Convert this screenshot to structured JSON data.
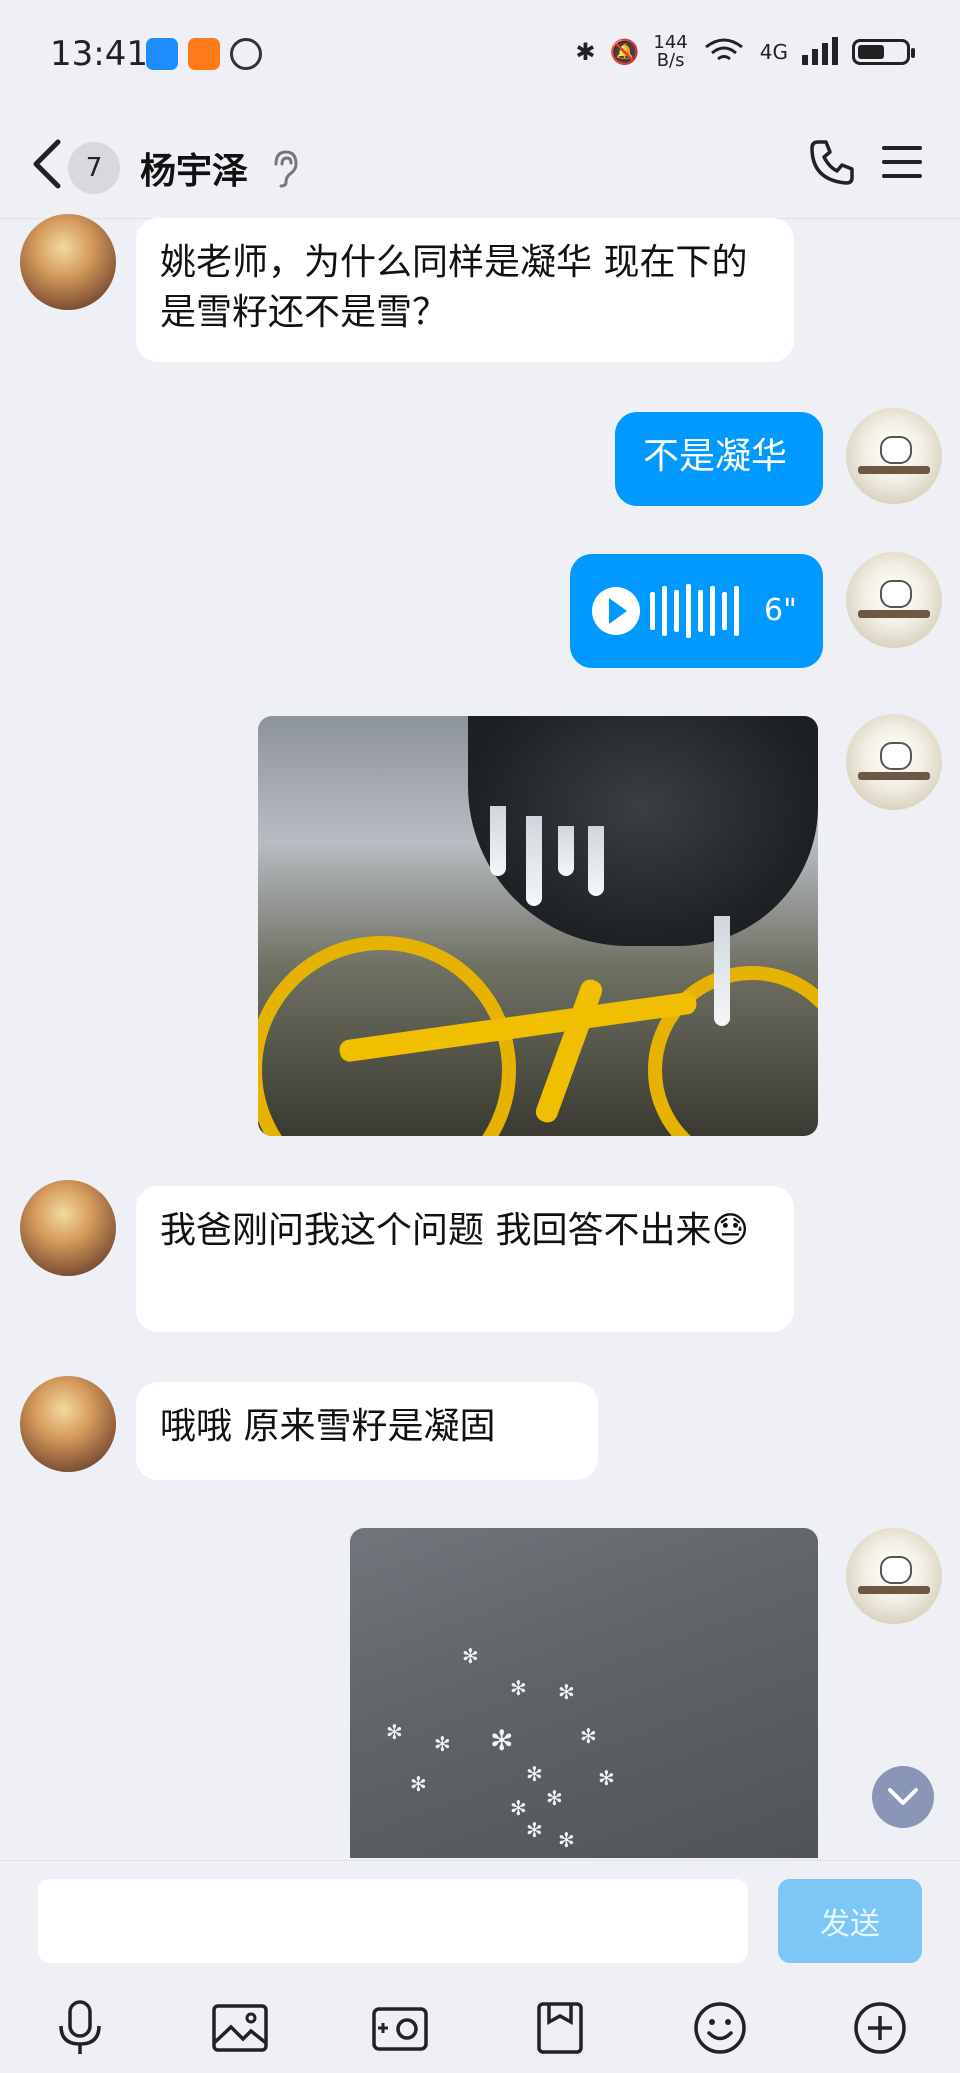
{
  "status_bar": {
    "time": "13:41",
    "net_speed_value": "144",
    "net_speed_unit": "B/s",
    "wifi_label": "6",
    "cell_label": "4G"
  },
  "header": {
    "unread_count": "7",
    "contact_name": "杨宇泽"
  },
  "messages": [
    {
      "from": "other",
      "type": "text",
      "text": "姚老师，为什么同样是凝华  现在下的是雪籽还不是雪？"
    },
    {
      "from": "me",
      "type": "text",
      "text": "不是凝华"
    },
    {
      "from": "me",
      "type": "voice",
      "duration": "6\""
    },
    {
      "from": "me",
      "type": "image",
      "description": "bike-icicles"
    },
    {
      "from": "other",
      "type": "text",
      "text": "我爸刚问我这个问题 我回答不出来😓"
    },
    {
      "from": "other",
      "type": "text",
      "text": "哦哦  原来雪籽是凝固"
    },
    {
      "from": "me",
      "type": "image",
      "description": "snowflakes-on-fabric"
    }
  ],
  "input": {
    "value": "",
    "send_label": "发送"
  },
  "toolbar": [
    "microphone-icon",
    "image-icon",
    "camera-icon",
    "file-icon",
    "emoji-icon",
    "plus-icon"
  ],
  "colors": {
    "accent": "#0099ff",
    "background": "#eef0f5",
    "send_disabled": "#7cc7f5"
  }
}
